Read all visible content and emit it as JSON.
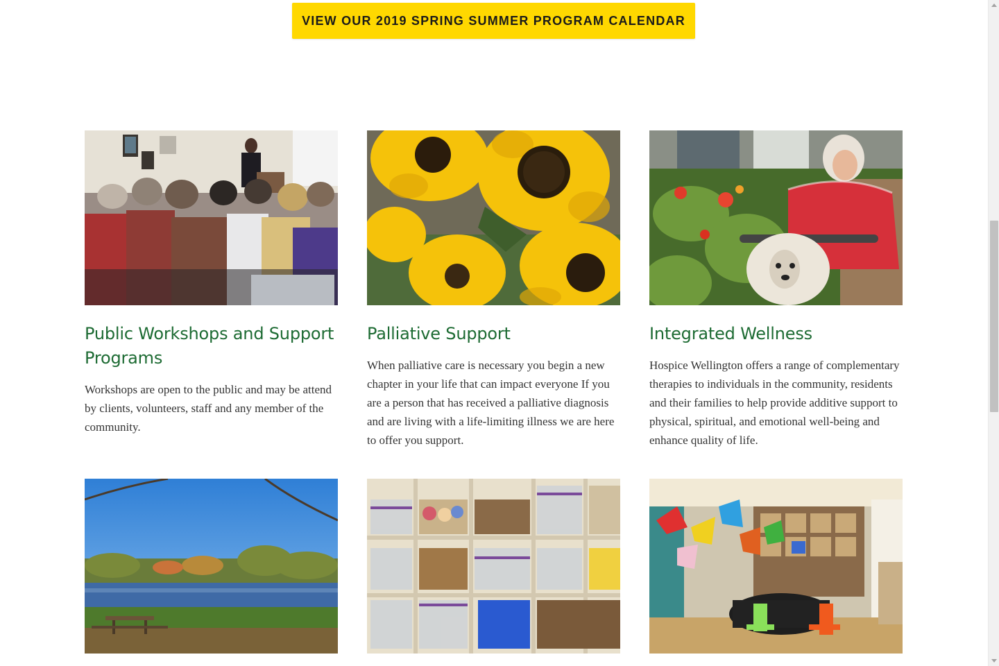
{
  "cta": {
    "label": "VIEW OUR 2019 SPRING SUMMER PROGRAM CALENDAR"
  },
  "colors": {
    "heading_green": "#1d6b33",
    "cta_yellow": "#ffd800",
    "body_text": "#333333"
  },
  "cards": [
    {
      "title": "Public Workshops and Support Programs",
      "text": "Workshops are open to the public and may be attend by clients, volunteers, staff and any member of the community."
    },
    {
      "title": "Palliative Support",
      "text": "When palliative care is necessary you begin a new chapter in your life that can impact everyone If you are a person that has received a palliative diagnosis and are living with a life-limiting illness we are here to offer you support."
    },
    {
      "title": "Integrated Wellness",
      "text": "Hospice Wellington offers a range of complementary therapies to individuals in the community, residents and their families to help provide additive support to physical, spiritual, and emotional well-being and enhance quality of life."
    }
  ]
}
